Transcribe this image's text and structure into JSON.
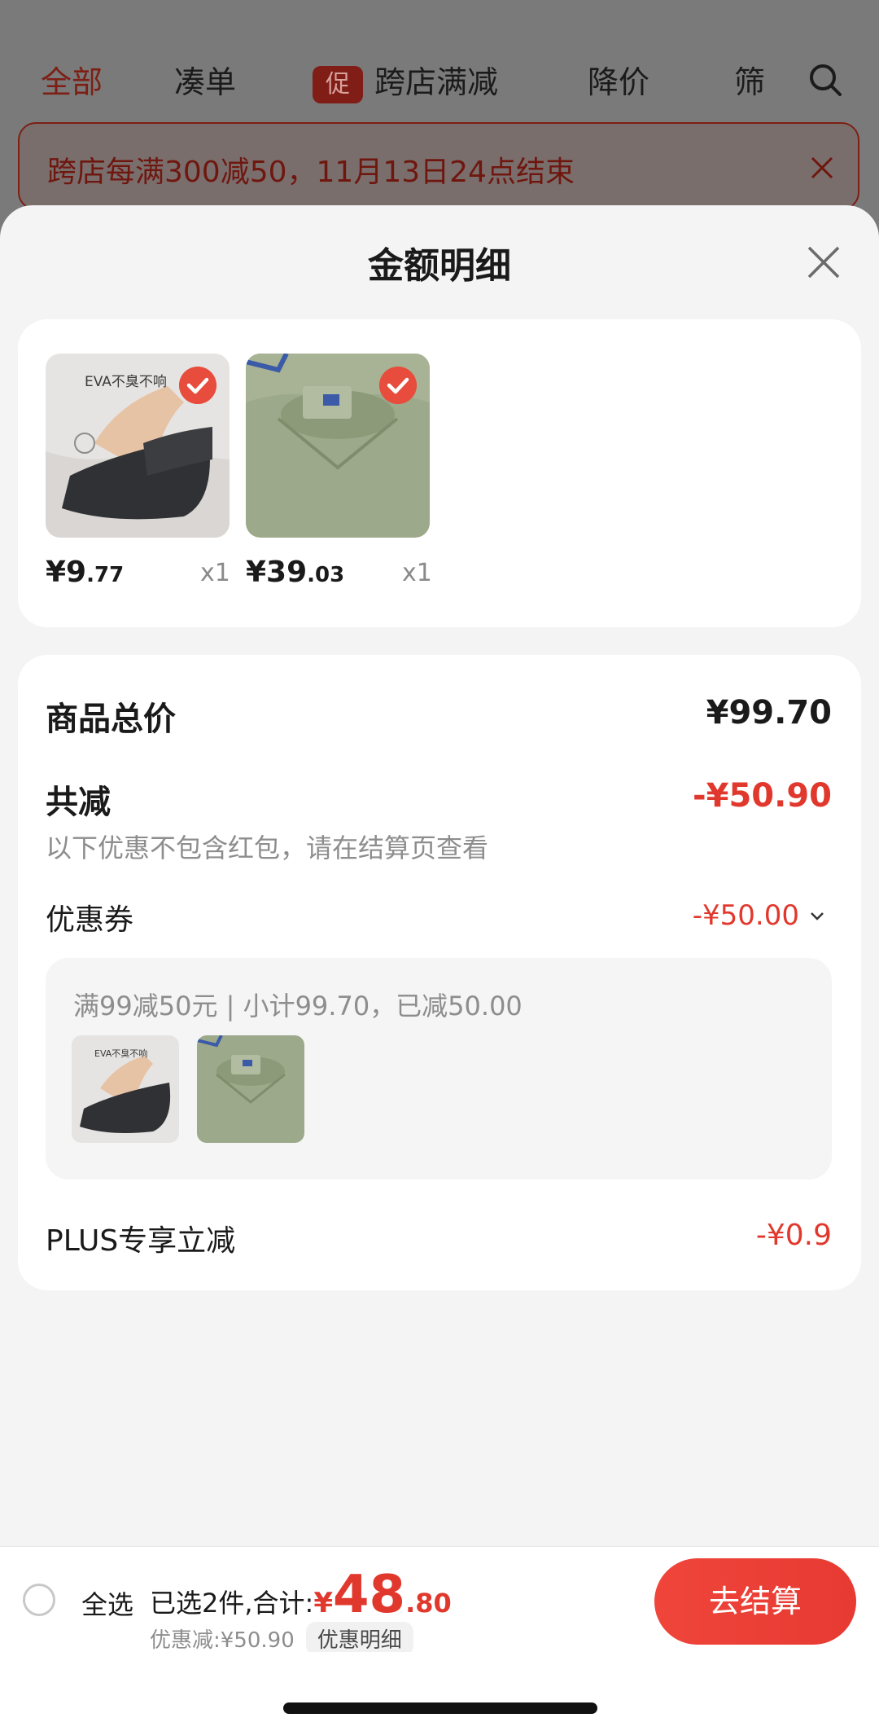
{
  "background": {
    "tabs": [
      {
        "label": "全部",
        "active": true
      },
      {
        "label": "凑单",
        "active": false
      },
      {
        "label": "跨店满减",
        "active": false,
        "badge": "促"
      },
      {
        "label": "降价",
        "active": false
      },
      {
        "label": "筛",
        "active": false
      }
    ],
    "banner": "跨店每满300减50，11月13日24点结束"
  },
  "sheet": {
    "title": "金额明细",
    "products": [
      {
        "price_int": "¥9",
        "price_dec": ".77",
        "qty": "x1",
        "image": "EVA slipper"
      },
      {
        "price_int": "¥39",
        "price_dec": ".03",
        "qty": "x1",
        "image": "green sweatshirt"
      }
    ],
    "total_label": "商品总价",
    "total_value": "¥99.70",
    "reduce_label": "共减",
    "reduce_value": "-¥50.90",
    "reduce_note": "以下优惠不包含红包，请在结算页查看",
    "coupon_label": "优惠券",
    "coupon_value": "-¥50.00",
    "coupon_detail": "满99减50元 | 小计99.70，已减50.00",
    "plus_label": "PLUS专享立减",
    "plus_value": "-¥0.9",
    "thumb_text": "EVA不臭不响",
    "mini_thumb_text": "EVA不臭不响"
  },
  "bottom_bar": {
    "select_all": "全选",
    "selected_summary": "已选2件,合计:",
    "total_currency": "¥",
    "total_int": "48",
    "total_dec": ".80",
    "discount_text": "优惠减:¥50.90",
    "detail_chip": "优惠明细",
    "checkout": "去结算"
  },
  "colors": {
    "accent_red": "#e1382d",
    "sheet_bg": "#f4f4f4",
    "card_bg": "#ffffff"
  }
}
